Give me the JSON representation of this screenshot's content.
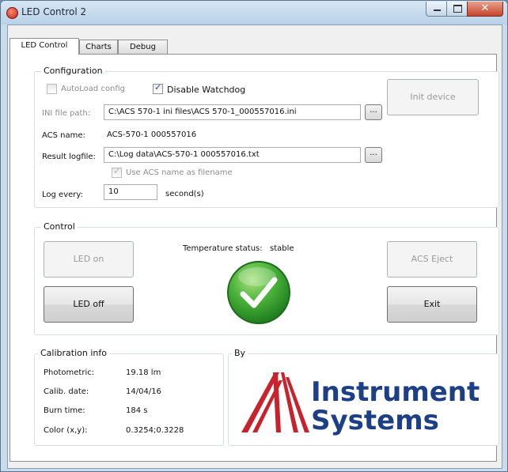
{
  "window": {
    "title": "LED Control 2"
  },
  "tabs": [
    {
      "label": "LED Control"
    },
    {
      "label": "Charts"
    },
    {
      "label": "Debug"
    }
  ],
  "configuration": {
    "legend": "Configuration",
    "autoload_label": "AutoLoad config",
    "autoload_checked": false,
    "watchdog_label": "Disable Watchdog",
    "watchdog_checked": true,
    "ini_label": "INI file path:",
    "ini_value": "C:\\ACS 570-1 ini files\\ACS 570-1_000557016.ini",
    "browse_label": "...",
    "init_button": "Init device",
    "acs_label": "ACS name:",
    "acs_value": "ACS-570-1 000557016",
    "logfile_label": "Result logfile:",
    "logfile_value": "C:\\Log data\\ACS-570-1 000557016.txt",
    "use_acs_label": "Use ACS name as filename",
    "use_acs_checked": true,
    "log_every_label": "Log every:",
    "log_every_value": "10",
    "log_every_unit": "second(s)"
  },
  "control": {
    "legend": "Control",
    "led_on": "LED on",
    "led_off": "LED off",
    "temp_label": "Temperature status:",
    "temp_value": "stable",
    "acs_eject": "ACS Eject",
    "exit": "Exit",
    "status_color": "#3aa52f"
  },
  "calibration": {
    "legend": "Calibration info",
    "rows": [
      {
        "label": "Photometric:",
        "value": "19.18 lm"
      },
      {
        "label": "Calib. date:",
        "value": "14/04/16"
      },
      {
        "label": "Burn time:",
        "value": "184 s"
      },
      {
        "label": "Color (x,y):",
        "value": "0.3254;0.3228"
      }
    ]
  },
  "by": {
    "legend": "By",
    "logo_line1": "Instrument",
    "logo_line2": "Systems",
    "logo_color": "#1d3f86",
    "logo_accent": "#c8232c"
  }
}
